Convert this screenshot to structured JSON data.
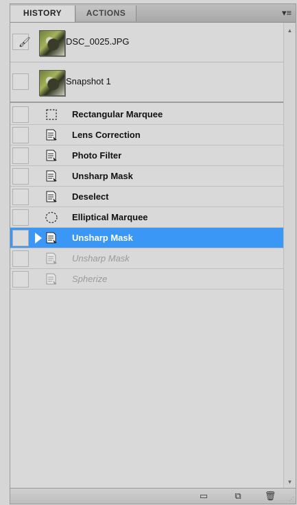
{
  "tabs": [
    {
      "label": "HISTORY",
      "active": true
    },
    {
      "label": "ACTIONS",
      "active": false
    }
  ],
  "menu_icon": "panel-menu-icon",
  "snapshots": [
    {
      "label": "DSC_0025.JPG",
      "history_brush_source": true
    },
    {
      "label": "Snapshot 1",
      "history_brush_source": false
    }
  ],
  "states": [
    {
      "label": "Rectangular Marquee",
      "icon": "rectangular-marquee-icon",
      "status": "normal"
    },
    {
      "label": "Lens Correction",
      "icon": "history-state-icon",
      "status": "normal"
    },
    {
      "label": "Photo Filter",
      "icon": "history-state-icon",
      "status": "normal"
    },
    {
      "label": "Unsharp Mask",
      "icon": "history-state-icon",
      "status": "normal"
    },
    {
      "label": "Deselect",
      "icon": "history-state-icon",
      "status": "normal"
    },
    {
      "label": "Elliptical Marquee",
      "icon": "elliptical-marquee-icon",
      "status": "normal"
    },
    {
      "label": "Unsharp Mask",
      "icon": "history-state-icon",
      "status": "selected"
    },
    {
      "label": "Unsharp Mask",
      "icon": "history-state-icon",
      "status": "disabled"
    },
    {
      "label": "Spherize",
      "icon": "history-state-icon",
      "status": "disabled"
    }
  ],
  "bottom_buttons": [
    {
      "icon": "new-document-from-state-icon"
    },
    {
      "icon": "create-snapshot-icon"
    },
    {
      "icon": "delete-state-icon"
    }
  ],
  "colors": {
    "selection": "#3b97f5"
  }
}
